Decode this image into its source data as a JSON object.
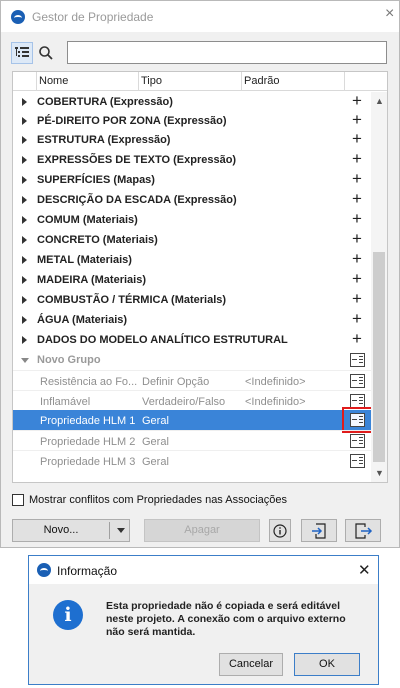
{
  "window": {
    "title": "Gestor de Propriedade",
    "close_glyph": "×",
    "search_placeholder": ""
  },
  "table": {
    "columns": [
      "Nome",
      "Tipo",
      "Padrão"
    ],
    "groups": [
      "COBERTURA (Expressão)",
      "PÉ-DIREITO POR ZONA (Expressão)",
      "ESTRUTURA (Expressão)",
      "EXPRESSÕES DE TEXTO (Expressão)",
      "SUPERFÍCIES (Mapas)",
      "DESCRIÇÃO DA ESCADA (Expressão)",
      "COMUM (Materiais)",
      "CONCRETO (Materiais)",
      "METAL (Materiais)",
      "MADEIRA (Materiais)",
      "COMBUSTÃO / TÉRMICA (Materials)",
      "ÁGUA (Materiais)",
      "DADOS DO MODELO ANALÍTICO ESTRUTURAL"
    ],
    "expanded_group": "Novo Grupo",
    "properties": [
      {
        "name": "Resistência ao Fo...",
        "type": "Definir Opção",
        "default": "<Indefinido>"
      },
      {
        "name": "Inflamável",
        "type": "Verdadeiro/Falso",
        "default": "<Indefinido>"
      },
      {
        "name": "Propriedade HLM 1",
        "type": "Geral",
        "default": ""
      },
      {
        "name": "Propriedade HLM 2",
        "type": "Geral",
        "default": ""
      },
      {
        "name": "Propriedade HLM 3",
        "type": "Geral",
        "default": ""
      }
    ],
    "selected_index": 2
  },
  "conflict_label": "Mostrar conflitos com Propriedades nas Associações",
  "buttons": {
    "new": "Novo...",
    "delete": "Apagar"
  },
  "dialog": {
    "title": "Informação",
    "close_glyph": "✕",
    "message": "Esta propriedade não é copiada e será editável neste projeto. A conexão com o arquivo externo não será mantida.",
    "info_glyph": "i",
    "cancel": "Cancelar",
    "ok": "OK"
  },
  "colors": {
    "selection": "#3a84d8",
    "highlight_box": "#e01b1b",
    "dialog_border": "#3c7ec8",
    "info_blue": "#1e6fd0"
  }
}
